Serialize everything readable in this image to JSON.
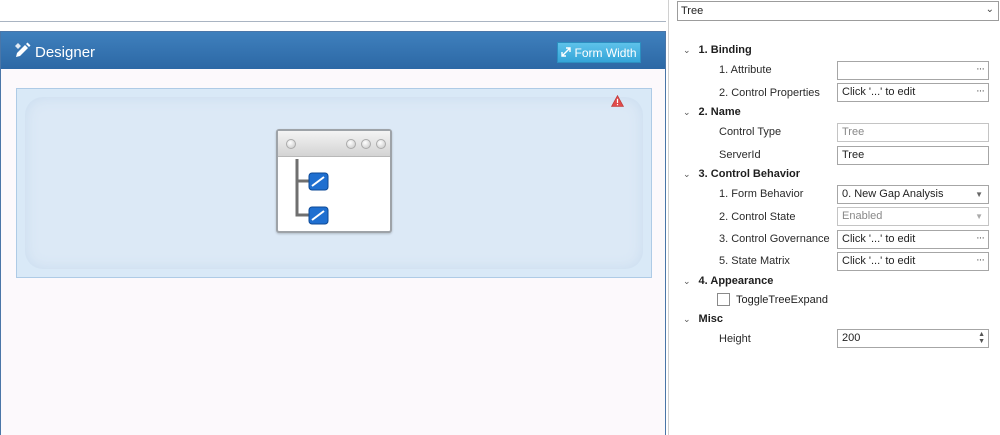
{
  "designer": {
    "title": "Designer",
    "form_width_label": "Form Width"
  },
  "property_panel": {
    "selected_control": "Tree",
    "sections": [
      {
        "title": "1. Binding"
      },
      {
        "title": "2. Name"
      },
      {
        "title": "3. Control Behavior"
      },
      {
        "title": "4. Appearance"
      },
      {
        "title": "Misc"
      }
    ],
    "properties": {
      "attribute": {
        "label": "1. Attribute",
        "value": ""
      },
      "control_properties": {
        "label": "2. Control Properties",
        "value": "Click '...' to edit"
      },
      "control_type": {
        "label": "Control Type",
        "value": "Tree"
      },
      "server_id": {
        "label": "ServerId",
        "value": "Tree"
      },
      "form_behavior": {
        "label": "1. Form Behavior",
        "value": "0. New Gap Analysis"
      },
      "control_state": {
        "label": "2. Control State",
        "value": "Enabled"
      },
      "control_governance": {
        "label": "3. Control Governance",
        "value": "Click '...' to edit"
      },
      "state_matrix": {
        "label": "5. State Matrix",
        "value": "Click '...' to edit"
      },
      "toggle_tree_expand": {
        "label": "ToggleTreeExpand",
        "checked": false
      },
      "height": {
        "label": "Height",
        "value": "200"
      }
    },
    "ellipsis": "···"
  },
  "colors": {
    "header_blue": "#2c68a5",
    "button_cyan": "#34a5d8",
    "canvas_blue": "#d9e9f7",
    "warning_red": "#e04b4b",
    "tree_node_blue": "#1f6fd0"
  },
  "icons": [
    "pencil-ruler-icon",
    "expand-arrows-icon",
    "warning-triangle-icon",
    "tree-control-icon",
    "chevron-down-icon",
    "ellipsis-icon",
    "spinner-icon"
  ]
}
